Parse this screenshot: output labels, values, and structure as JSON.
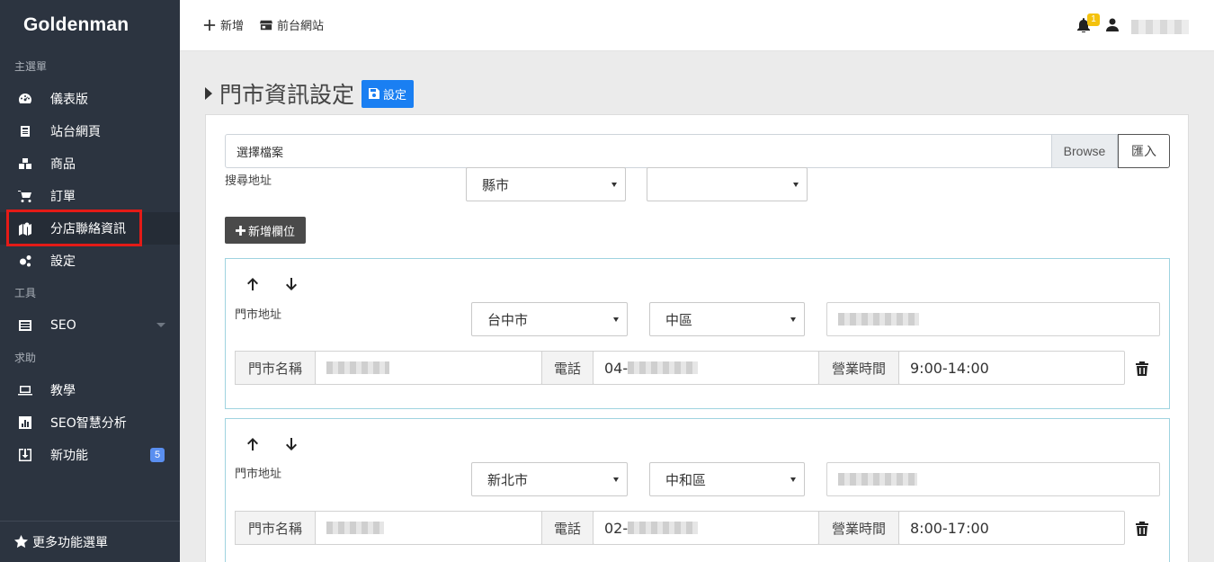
{
  "sidebar": {
    "brand": "Goldenman",
    "sections": {
      "main": "主選單",
      "tools": "工具",
      "help": "求助"
    },
    "items": [
      {
        "label": "儀表版",
        "icon": "dashboard-icon"
      },
      {
        "label": "站台網頁",
        "icon": "page-icon"
      },
      {
        "label": "商品",
        "icon": "boxes-icon"
      },
      {
        "label": "訂單",
        "icon": "cart-icon"
      },
      {
        "label": "分店聯絡資訊",
        "icon": "map-icon"
      },
      {
        "label": "設定",
        "icon": "gears-icon"
      },
      {
        "label": "SEO",
        "icon": "list-icon"
      },
      {
        "label": "教學",
        "icon": "laptop-icon"
      },
      {
        "label": "SEO智慧分析",
        "icon": "chart-icon"
      },
      {
        "label": "新功能",
        "icon": "download-icon",
        "badge": "5"
      }
    ],
    "more_menu": "更多功能選單"
  },
  "topbar": {
    "add_label": "新增",
    "storefront_label": "前台網站",
    "notification_count": "1"
  },
  "page": {
    "title": "門市資訊設定",
    "save_label": "設定"
  },
  "form": {
    "file_placeholder": "選擇檔案",
    "browse_label": "Browse",
    "import_label": "匯入",
    "search_address_label": "搜尋地址",
    "city_select": "縣市",
    "district_select": "",
    "add_field_label": "新增欄位"
  },
  "stores": [
    {
      "address_label": "門市地址",
      "city": "台中市",
      "district": "中區",
      "name_label": "門市名稱",
      "phone_label": "電話",
      "phone_prefix": "04-",
      "hours_label": "營業時間",
      "hours": "9:00-14:00"
    },
    {
      "address_label": "門市地址",
      "city": "新北市",
      "district": "中和區",
      "name_label": "門市名稱",
      "phone_label": "電話",
      "phone_prefix": "02-",
      "hours_label": "營業時間",
      "hours": "8:00-17:00"
    }
  ],
  "colors": {
    "sidebar_bg": "#2c3440",
    "highlight": "#e41b17",
    "primary": "#1a7ff2",
    "block_border": "#9fd3e0"
  }
}
